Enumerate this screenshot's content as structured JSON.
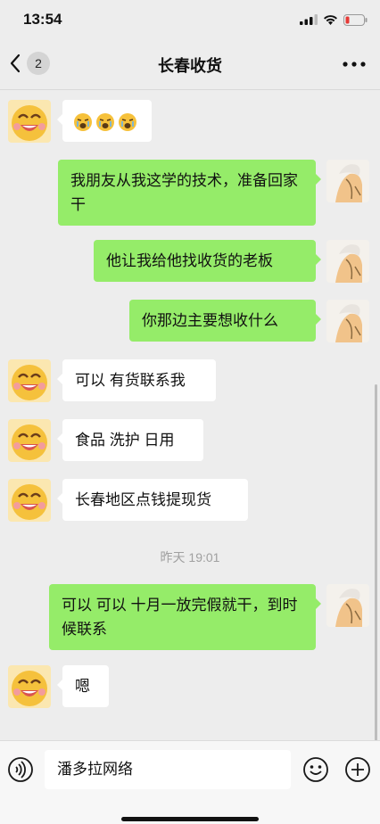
{
  "status_bar": {
    "time": "13:54"
  },
  "nav": {
    "back_count": "2",
    "title": "长春收货"
  },
  "messages": [
    {
      "side": "left",
      "text": "",
      "emoji_count": 3
    },
    {
      "side": "right",
      "text": "我朋友从我这学的技术，准备回家干"
    },
    {
      "side": "right",
      "text": "他让我给他找收货的老板"
    },
    {
      "side": "right",
      "text": "你那边主要想收什么"
    },
    {
      "side": "left",
      "text": "可以 有货联系我"
    },
    {
      "side": "left",
      "text": "食品 洗护 日用"
    },
    {
      "side": "left",
      "text": "长春地区点钱提现货"
    },
    {
      "side": "right",
      "text": "可以 可以  十月一放完假就干，到时候联系"
    },
    {
      "side": "left",
      "text": "嗯"
    }
  ],
  "timestamp": "昨天 19:01",
  "input": {
    "value": "潘多拉网络"
  },
  "colors": {
    "background": "#ededed",
    "bubble_self": "#95ec69",
    "bubble_other": "#ffffff"
  },
  "icons": {
    "back": "chevron-left-icon",
    "more": "more-dots-icon",
    "voice": "voice-icon",
    "emoji": "emoji-icon",
    "plus": "plus-icon"
  }
}
